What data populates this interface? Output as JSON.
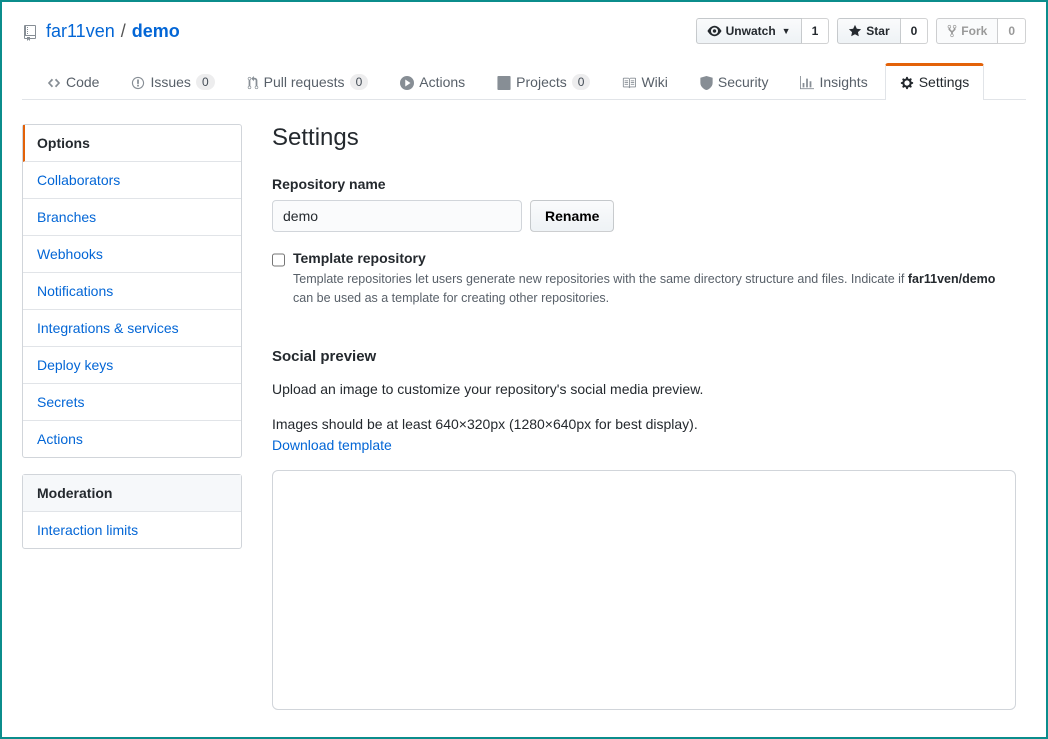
{
  "header": {
    "owner": "far11ven",
    "separator": "/",
    "name": "demo",
    "unwatch": "Unwatch",
    "unwatch_count": "1",
    "star": "Star",
    "star_count": "0",
    "fork": "Fork",
    "fork_count": "0"
  },
  "tabs": {
    "code": "Code",
    "issues": "Issues",
    "issues_count": "0",
    "pulls": "Pull requests",
    "pulls_count": "0",
    "actions": "Actions",
    "projects": "Projects",
    "projects_count": "0",
    "wiki": "Wiki",
    "security": "Security",
    "insights": "Insights",
    "settings": "Settings"
  },
  "sidebar": {
    "main": [
      "Options",
      "Collaborators",
      "Branches",
      "Webhooks",
      "Notifications",
      "Integrations & services",
      "Deploy keys",
      "Secrets",
      "Actions"
    ],
    "mod_heading": "Moderation",
    "mod_items": [
      "Interaction limits"
    ]
  },
  "main": {
    "page_title": "Settings",
    "repo_name_label": "Repository name",
    "repo_name_value": "demo",
    "rename_btn": "Rename",
    "template_title": "Template repository",
    "template_help_a": "Template repositories let users generate new repositories with the same directory structure and files. Indicate if ",
    "template_help_b": "far11ven/demo",
    "template_help_c": " can be used as a template for creating other repositories.",
    "social_heading": "Social preview",
    "social_p1": "Upload an image to customize your repository's social media preview.",
    "social_p2": "Images should be at least 640×320px (1280×640px for best display).",
    "download_template": "Download template"
  }
}
